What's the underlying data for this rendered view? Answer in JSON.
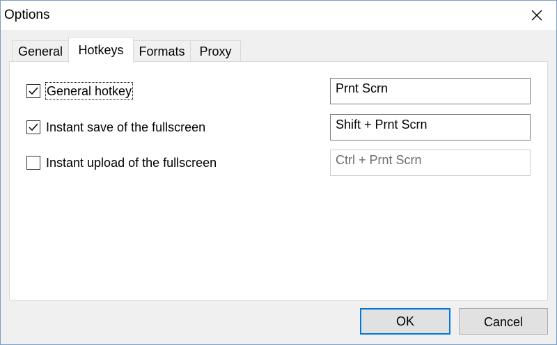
{
  "window": {
    "title": "Options"
  },
  "tabs": [
    {
      "label": "General",
      "active": false
    },
    {
      "label": "Hotkeys",
      "active": true
    },
    {
      "label": "Formats",
      "active": false
    },
    {
      "label": "Proxy",
      "active": false
    }
  ],
  "hotkeys": [
    {
      "label": "General hotkey",
      "checked": true,
      "value": "Prnt Scrn",
      "enabled": true
    },
    {
      "label": "Instant save of the fullscreen",
      "checked": true,
      "value": "Shift + Prnt Scrn",
      "enabled": true
    },
    {
      "label": "Instant upload of the fullscreen",
      "checked": false,
      "value": "Ctrl + Prnt Scrn",
      "enabled": false
    }
  ],
  "buttons": {
    "ok": "OK",
    "cancel": "Cancel"
  },
  "colors": {
    "accent": "#0078d7",
    "window_border": "#7a9cc6",
    "background": "#f0f0f0"
  },
  "icons": {
    "close": "close-icon",
    "check": "checkmark-icon"
  }
}
